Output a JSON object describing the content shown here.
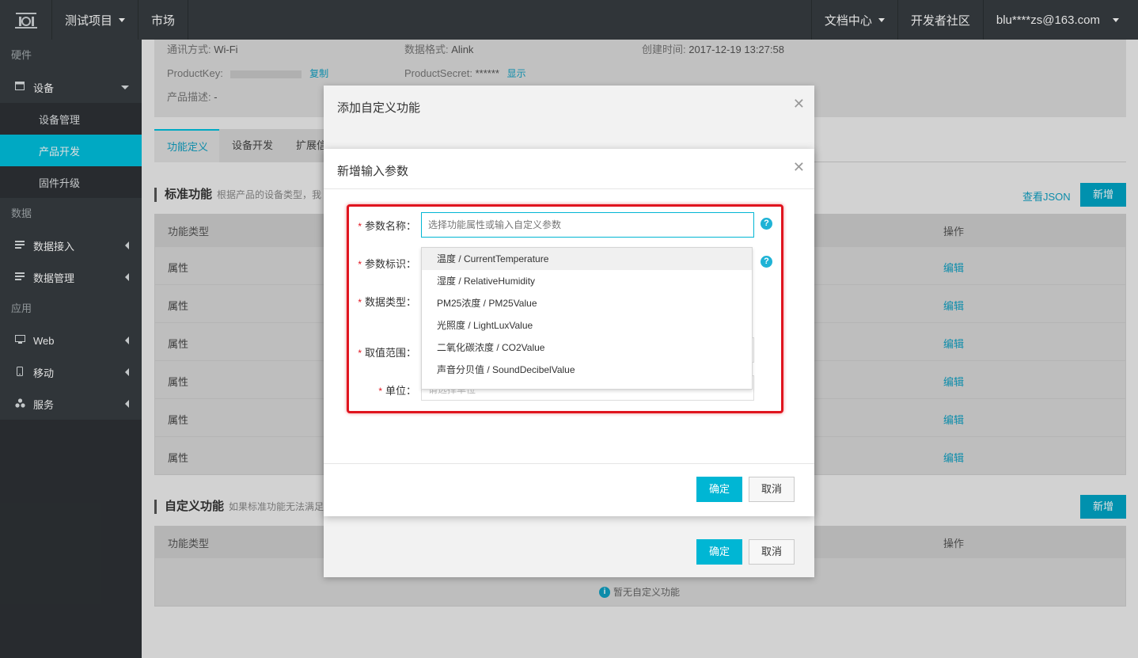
{
  "topbar": {
    "project": "测试项目",
    "market": "市场",
    "docs": "文档中心",
    "community": "开发者社区",
    "user": "blu****zs@163.com"
  },
  "sidebar": {
    "group_hardware": "硬件",
    "device": "设备",
    "device_sub": [
      "设备管理",
      "产品开发",
      "固件升级"
    ],
    "group_data": "数据",
    "data_items": [
      "数据接入",
      "数据管理"
    ],
    "group_app": "应用",
    "app_items": [
      "Web",
      "移动",
      "服务"
    ]
  },
  "product_info": {
    "comm_label": "通讯方式:",
    "comm_value": "Wi-Fi",
    "format_label": "数据格式:",
    "format_value": "Alink",
    "created_label": "创建时间:",
    "created_value": "2017-12-19 13:27:58",
    "key_label": "ProductKey:",
    "copy_link": "复制",
    "secret_label": "ProductSecret:",
    "secret_value": "******",
    "show_link": "显示",
    "desc_label": "产品描述:",
    "desc_value": "-"
  },
  "tabs": [
    "功能定义",
    "设备开发",
    "扩展信"
  ],
  "standard": {
    "title": "标准功能",
    "desc": "根据产品的设备类型，我",
    "view_json": "查看JSON",
    "add": "新增",
    "col_type": "功能类型",
    "col_action": "操作",
    "rows": [
      "属性",
      "属性",
      "属性",
      "属性",
      "属性",
      "属性"
    ],
    "edit": "编辑"
  },
  "custom": {
    "title": "自定义功能",
    "desc": "如果标准功能无法满足",
    "add": "新增",
    "col_type": "功能类型",
    "col_action": "操作",
    "empty": "暂无自定义功能"
  },
  "outer_dialog": {
    "title": "添加自定义功能",
    "ok": "确定",
    "cancel": "取消"
  },
  "inner_dialog": {
    "title": "新增输入参数",
    "param_name_label": "参数名称：",
    "param_name_placeholder": "选择功能属性或输入自定义参数",
    "param_id_label": "参数标识：",
    "data_type_label": "数据类型：",
    "range_label": "取值范围：",
    "unit_label": "单位：",
    "unit_placeholder": "请选择单位",
    "ok": "确定",
    "cancel": "取消",
    "help": "?",
    "options": [
      "温度 / CurrentTemperature",
      "湿度 / RelativeHumidity",
      "PM25浓度 / PM25Value",
      "光照度 / LightLuxValue",
      "二氧化碳浓度 / CO2Value",
      "声音分贝值 / SoundDecibelValue"
    ]
  },
  "colors": {
    "accent": "#00c1de",
    "topbar": "#373d41",
    "highlight_box": "#e0141e",
    "link": "#0fa0c2"
  }
}
